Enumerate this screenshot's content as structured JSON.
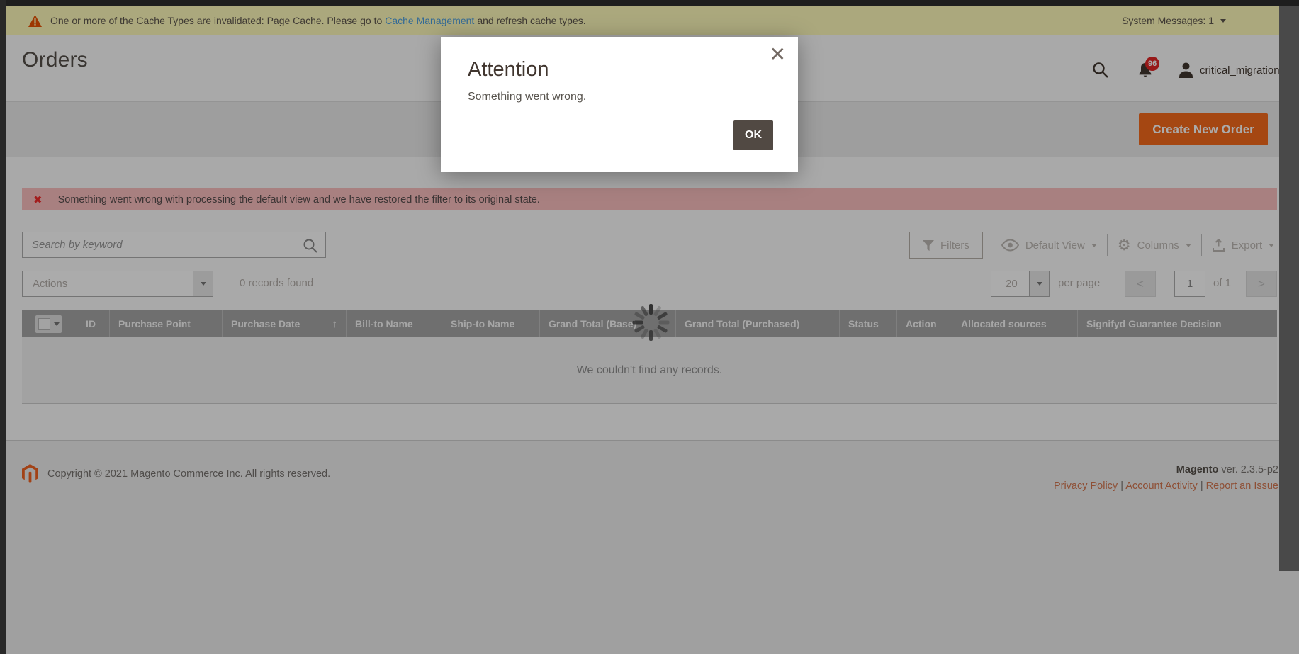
{
  "colors": {
    "accent": "#eb5202",
    "dark_button": "#514943",
    "badge_red": "#e22626",
    "warning_bar_bg": "#fffbbb",
    "error_bar_bg": "#fbbfbf"
  },
  "icons": {
    "sort_asc": "↑",
    "close": "✕",
    "error_mark": "✖",
    "prev": "<",
    "next": ">",
    "gear": "⚙"
  },
  "system_bar": {
    "warning_prefix": "One or more of the Cache Types are invalidated: Page Cache. Please go to",
    "warning_link": "Cache Management",
    "warning_suffix": "and refresh cache types.",
    "system_messages": "System Messages: 1"
  },
  "header": {
    "title": "Orders",
    "username": "critical_migration",
    "notification_count": "96"
  },
  "page_actions": {
    "create_button": "Create New Order"
  },
  "error_banner": {
    "text": "Something went wrong with processing the default view and we have restored the filter to its original state."
  },
  "grid_toolbar": {
    "search_placeholder": "Search by keyword",
    "filters": "Filters",
    "view": "Default View",
    "columns": "Columns",
    "export": "Export"
  },
  "actions_bar": {
    "actions": "Actions",
    "records": "0 records found",
    "per_page_value": "20",
    "per_page": "per page",
    "page": "1",
    "of_total": "of 1"
  },
  "grid": {
    "columns": [
      "ID",
      "Purchase Point",
      "Purchase Date",
      "Bill-to Name",
      "Ship-to Name",
      "Grand Total (Base)",
      "Grand Total (Purchased)",
      "Status",
      "Action",
      "Allocated sources",
      "Signifyd Guarantee Decision"
    ],
    "empty": "We couldn't find any records."
  },
  "modal": {
    "title": "Attention",
    "message": "Something went wrong.",
    "ok": "OK"
  },
  "footer": {
    "copyright": "Copyright © 2021 Magento Commerce Inc. All rights reserved.",
    "brand": "Magento",
    "version": "ver. 2.3.5-p2",
    "links": [
      "Privacy Policy",
      "Account Activity",
      "Report an Issue"
    ],
    "link_sep": "|"
  }
}
